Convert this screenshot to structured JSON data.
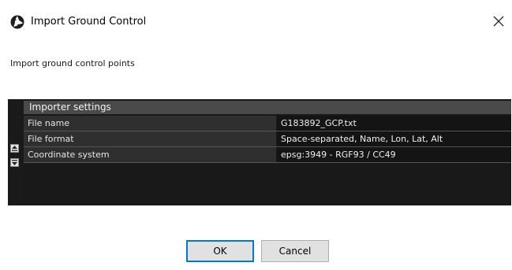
{
  "window": {
    "title": "Import Ground Control",
    "app_icon": "camera-aperture-icon",
    "close_icon": "close-icon"
  },
  "subtitle": "Import ground control points",
  "settings": {
    "header": "Importer settings",
    "rows": [
      {
        "key": "File name",
        "value": "G183892_GCP.txt"
      },
      {
        "key": "File format",
        "value": "Space-separated, Name, Lon, Lat, Alt"
      },
      {
        "key": "Coordinate system",
        "value": "epsg:3949 - RGF93 / CC49"
      }
    ],
    "side_buttons": [
      "expand-all-icon",
      "collapse-all-icon"
    ]
  },
  "buttons": {
    "ok_label": "OK",
    "cancel_label": "Cancel"
  },
  "colors": {
    "panel_bg": "#191919",
    "header_bg": "#4a4a4a",
    "default_button_border": "#0078d7"
  }
}
